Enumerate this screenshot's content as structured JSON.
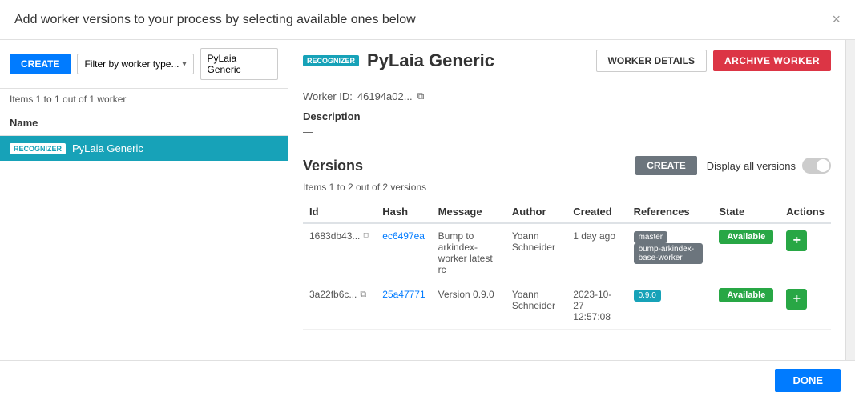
{
  "modal": {
    "title": "Add worker versions to your process by selecting available ones below",
    "close_label": "×"
  },
  "left_panel": {
    "create_button": "CREATE",
    "filter_label": "Filter by worker type...",
    "filter_value": "PyLaia Generic",
    "items_count": "Items 1 to 1 out of 1 worker",
    "list_header": "Name",
    "workers": [
      {
        "badge": "RECOGNIZER",
        "name": "PyLaia Generic",
        "selected": true
      }
    ]
  },
  "right_panel": {
    "worker_badge": "RECOGNIZER",
    "worker_title": "PyLaia Generic",
    "worker_details_btn": "WORKER DETAILS",
    "archive_btn": "ARCHIVE WORKER",
    "worker_id_label": "Worker ID:",
    "worker_id_value": "46194a02...",
    "description_label": "Description",
    "description_value": "—",
    "versions": {
      "title": "Versions",
      "create_btn": "CREATE",
      "display_all_label": "Display all versions",
      "count": "Items 1 to 2 out of 2 versions",
      "table_headers": [
        "Id",
        "Hash",
        "Message",
        "Author",
        "Created",
        "References",
        "State",
        "Actions"
      ],
      "rows": [
        {
          "id": "1683db43...",
          "hash": "ec6497ea",
          "message": "Bump to arkindex-worker latest rc",
          "author": "Yoann Schneider",
          "created": "1 day ago",
          "references": [
            "master",
            "bump-arkindex-base-worker"
          ],
          "state": "Available"
        },
        {
          "id": "3a22fb6c...",
          "hash": "25a47771",
          "message": "Version 0.9.0",
          "author": "Yoann Schneider",
          "created": "2023-10-27 12:57:08",
          "references": [
            "0.9.0"
          ],
          "state": "Available"
        }
      ]
    }
  },
  "footer": {
    "done_btn": "DONE"
  }
}
